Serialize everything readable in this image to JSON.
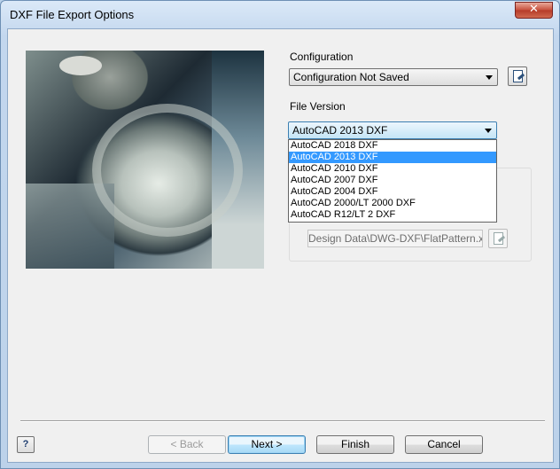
{
  "window": {
    "title": "DXF File Export Options",
    "close_glyph": "✕"
  },
  "configuration": {
    "label": "Configuration",
    "value": "Configuration Not Saved"
  },
  "file_version": {
    "label": "File Version",
    "value": "AutoCAD 2013 DXF",
    "options": [
      "AutoCAD 2018 DXF",
      "AutoCAD 2013 DXF",
      "AutoCAD 2010 DXF",
      "AutoCAD 2007 DXF",
      "AutoCAD 2004 DXF",
      "AutoCAD 2000/LT 2000 DXF",
      "AutoCAD R12/LT 2 DXF"
    ],
    "selected_index": 1
  },
  "customize": {
    "path_value": "Design Data\\DWG-DXF\\FlatPattern.xml"
  },
  "footer": {
    "help_glyph": "?",
    "back_label": "< Back",
    "next_label": "Next >",
    "finish_label": "Finish",
    "cancel_label": "Cancel"
  },
  "colors": {
    "selection": "#3399ff",
    "title_bar": "#c3d7ee"
  }
}
